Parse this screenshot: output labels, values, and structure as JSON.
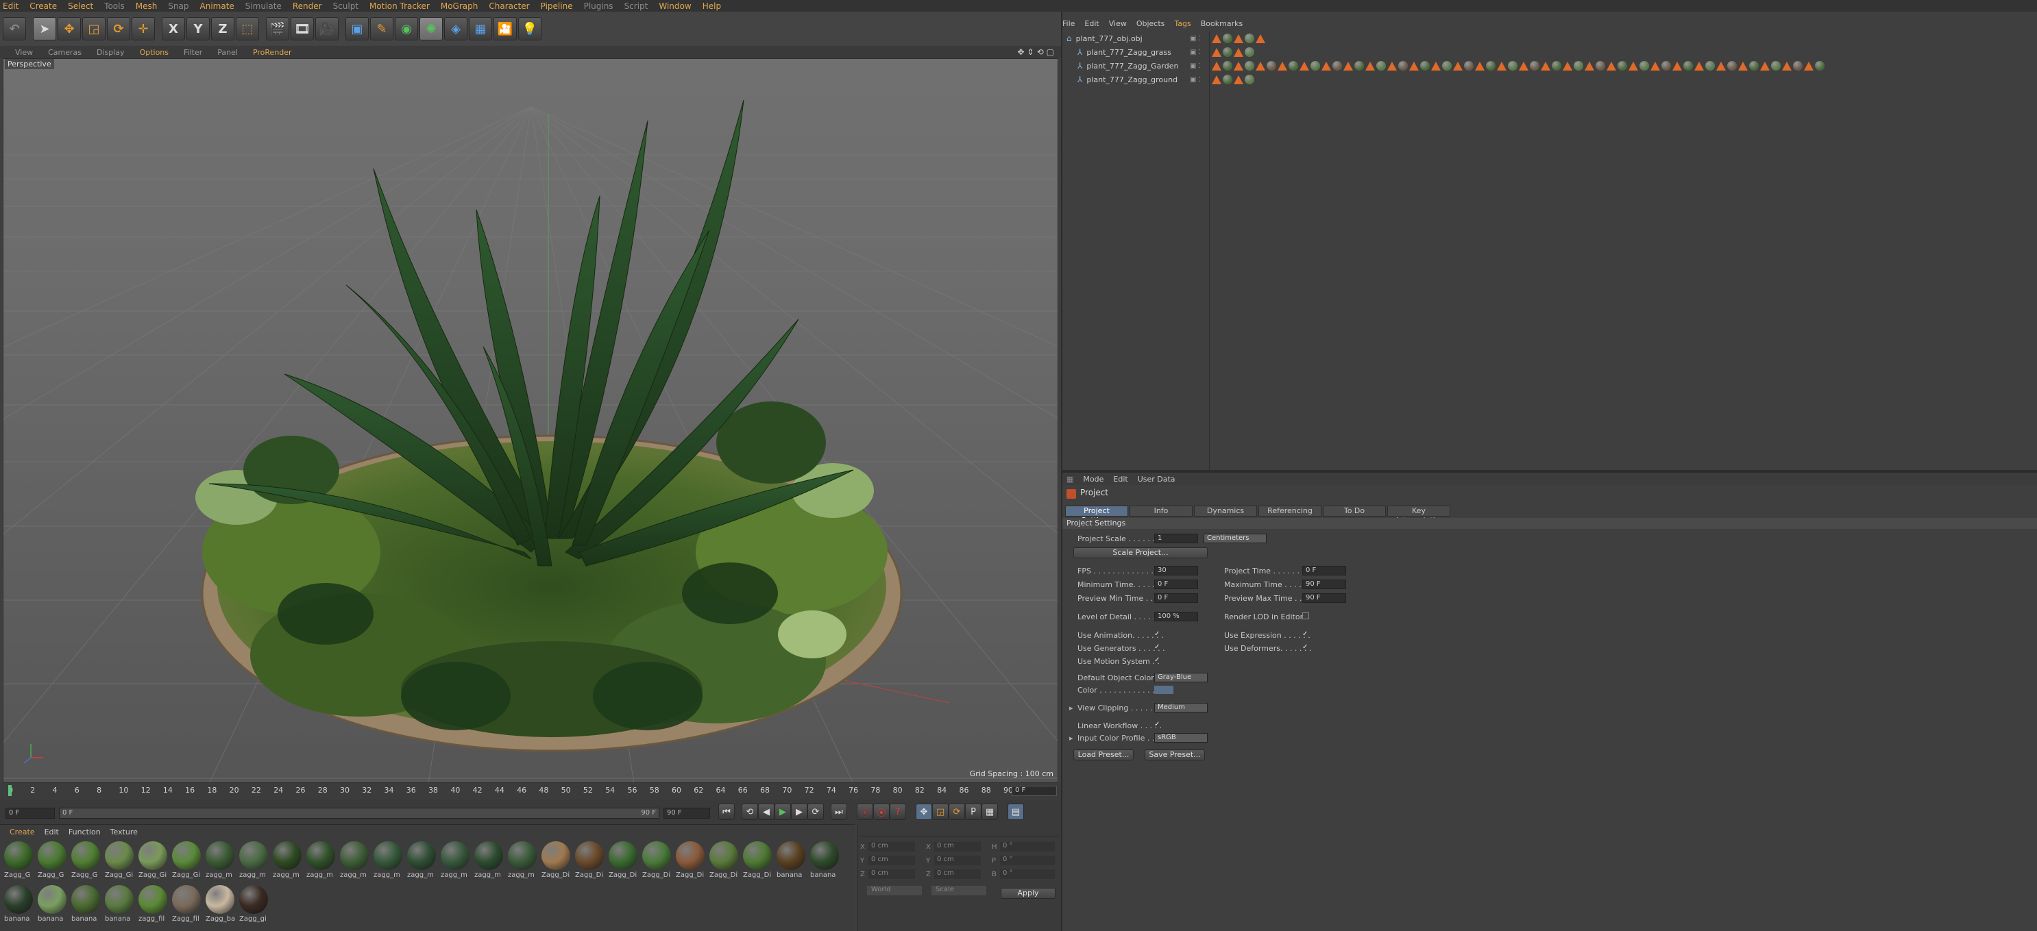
{
  "menubar": [
    "Edit",
    "Create",
    "Select",
    "Tools",
    "Mesh",
    "Snap",
    "Animate",
    "Simulate",
    "Render",
    "Sculpt",
    "Motion Tracker",
    "MoGraph",
    "Character",
    "Pipeline",
    "Plugins",
    "Script",
    "Window",
    "Help"
  ],
  "toolbar": {
    "axis_x": "X",
    "axis_y": "Y",
    "axis_z": "Z"
  },
  "viewport": {
    "menu": [
      "View",
      "Cameras",
      "Display",
      "Options",
      "Filter",
      "Panel",
      "ProRender"
    ],
    "camera": "Perspective",
    "grid_spacing": "Grid Spacing : 100 cm"
  },
  "timeline": {
    "ticks": [
      "0",
      "2",
      "4",
      "6",
      "8",
      "10",
      "12",
      "14",
      "16",
      "18",
      "20",
      "22",
      "24",
      "26",
      "28",
      "30",
      "32",
      "34",
      "36",
      "38",
      "40",
      "42",
      "44",
      "46",
      "48",
      "50",
      "52",
      "54",
      "56",
      "58",
      "60",
      "62",
      "64",
      "66",
      "68",
      "70",
      "72",
      "74",
      "76",
      "78",
      "80",
      "82",
      "84",
      "86",
      "88",
      "90"
    ],
    "current_frame": "0 F",
    "start": "0 F",
    "min": "0 F",
    "max": "90 F",
    "end": "90 F"
  },
  "materials": {
    "menu": [
      "Create",
      "Edit",
      "Function",
      "Texture"
    ],
    "row1": [
      {
        "label": "Zagg_G",
        "color": "#3d6a2a"
      },
      {
        "label": "Zagg_G",
        "color": "#4a7a30"
      },
      {
        "label": "Zagg_G",
        "color": "#507f32"
      },
      {
        "label": "Zagg_Gi",
        "color": "#6a8a4a"
      },
      {
        "label": "Zagg_Gi",
        "color": "#7a9a5a"
      },
      {
        "label": "Zagg_Gi",
        "color": "#5a8a3a"
      },
      {
        "label": "zagg_m",
        "color": "#3a5a34"
      },
      {
        "label": "zagg_m",
        "color": "#4a6a44"
      },
      {
        "label": "zagg_m",
        "color": "#2e4a22"
      },
      {
        "label": "zagg_m",
        "color": "#30502a"
      },
      {
        "label": "zagg_m",
        "color": "#3e5e36"
      },
      {
        "label": "zagg_m",
        "color": "#35583a"
      },
      {
        "label": "zagg_m",
        "color": "#2e4e34"
      },
      {
        "label": "zagg_m",
        "color": "#38583c"
      },
      {
        "label": "zagg_m",
        "color": "#2c4c2e"
      },
      {
        "label": "zagg_m",
        "color": "#3a5a3a"
      },
      {
        "label": "Zagg_Di",
        "color": "#a07a50"
      },
      {
        "label": "Zagg_Di",
        "color": "#6a4a2a"
      },
      {
        "label": "Zagg_Di",
        "color": "#3a6a30"
      },
      {
        "label": "Zagg_Di",
        "color": "#4a7a3a"
      },
      {
        "label": "Zagg_Di",
        "color": "#8a5a3a"
      },
      {
        "label": "Zagg_Di",
        "color": "#5a7a3a"
      },
      {
        "label": "Zagg_Di",
        "color": "#4e7a34"
      },
      {
        "label": "banana",
        "color": "#5a4020"
      },
      {
        "label": "banana",
        "color": "#2e4a2a"
      }
    ],
    "row2": [
      {
        "label": "banana",
        "color": "#2a3e2a"
      },
      {
        "label": "banana",
        "color": "#7aa060"
      },
      {
        "label": "banana",
        "color": "#4a6a30"
      },
      {
        "label": "banana",
        "color": "#5a7a40"
      },
      {
        "label": "zagg_fil",
        "color": "#5a8a34"
      },
      {
        "label": "Zagg_fil",
        "color": "#7a6a5a"
      },
      {
        "label": "Zagg_ba",
        "color": "#c8b8a0"
      },
      {
        "label": "Zagg_gi",
        "color": "#3a2a22"
      }
    ]
  },
  "coords": {
    "x_label": "X",
    "y_label": "Y",
    "z_label": "Z",
    "x_pos": "0 cm",
    "y_pos": "0 cm",
    "z_pos": "0 cm",
    "x_size": "0 cm",
    "y_size": "0 cm",
    "z_size": "0 cm",
    "h_label": "H",
    "p_label": "P",
    "b_label": "B",
    "h_val": "0 °",
    "p_val": "0 °",
    "b_val": "0 °",
    "mode_world": "World",
    "mode_scale": "Scale",
    "apply": "Apply"
  },
  "object_manager": {
    "menu": [
      "File",
      "Edit",
      "View",
      "Objects",
      "Tags",
      "Bookmarks"
    ],
    "objects": [
      {
        "name": "plant_777_obj.obj",
        "indent": 0
      },
      {
        "name": "plant_777_Zagg_grass",
        "indent": 1
      },
      {
        "name": "plant_777_Zagg_Garden",
        "indent": 1
      },
      {
        "name": "plant_777_Zagg_ground",
        "indent": 1
      }
    ]
  },
  "attributes": {
    "menu": [
      "Mode",
      "Edit",
      "User Data"
    ],
    "title": "Project",
    "tabs": [
      "Project Settings",
      "Info",
      "Dynamics",
      "Referencing",
      "To Do",
      "Key Interpolation"
    ],
    "section": "Project Settings",
    "project_scale_label": "Project Scale . . . . . .",
    "project_scale_value": "1",
    "project_scale_unit": "Centimeters",
    "scale_project_btn": "Scale Project...",
    "fps_label": "FPS . . . . . . . . . . . . . .",
    "fps_value": "30",
    "project_time_label": "Project Time . . . . . . . .",
    "project_time_value": "0 F",
    "min_time_label": "Minimum Time. . . . . . .",
    "min_time_value": "0 F",
    "max_time_label": "Maximum Time . . . . . .",
    "max_time_value": "90 F",
    "prev_min_label": "Preview Min Time . . .",
    "prev_min_value": "0 F",
    "prev_max_label": "Preview Max Time . . .",
    "prev_max_value": "90 F",
    "lod_label": "Level of Detail . . . . . .",
    "lod_value": "100 %",
    "render_lod_label": "Render LOD in Editor",
    "use_anim_label": "Use Animation. . . . . . .",
    "use_expr_label": "Use Expression . . . . . .",
    "use_gen_label": "Use Generators . . . . . .",
    "use_def_label": "Use Deformers. . . . . . .",
    "use_motion_label": "Use Motion System . .",
    "def_color_label": "Default Object Color",
    "def_color_value": "Gray-Blue",
    "color_label": "Color . . . . . . . . . . . . .",
    "clipping_label": "View Clipping . . . . . . .",
    "clipping_value": "Medium",
    "linear_label": "Linear Workflow . . . . .",
    "input_profile_label": "Input Color Profile . . .",
    "input_profile_value": "sRGB",
    "load_preset": "Load Preset...",
    "save_preset": "Save Preset...",
    "check": "✓"
  }
}
